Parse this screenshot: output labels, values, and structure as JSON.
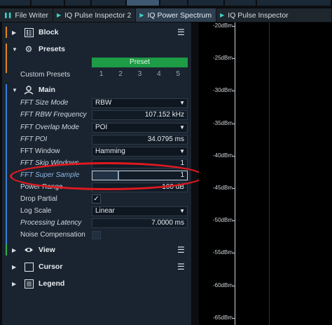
{
  "tabs": [
    {
      "label": "File Writer",
      "icon": "pause-icon",
      "active": false
    },
    {
      "label": "IQ Pulse Inspector 2",
      "icon": "play-icon",
      "active": false
    },
    {
      "label": "IQ Power Spectrum",
      "icon": "play-icon",
      "active": true
    },
    {
      "label": "IQ Pulse Inspector",
      "icon": "play-icon",
      "active": false
    }
  ],
  "sections": {
    "block": {
      "title": "Block",
      "expanded": false
    },
    "presets": {
      "title": "Presets",
      "expanded": true,
      "preset_button": "Preset",
      "custom_presets_label": "Custom Presets",
      "numbers": [
        "1",
        "2",
        "3",
        "4",
        "5"
      ]
    },
    "main": {
      "title": "Main",
      "expanded": true
    },
    "view": {
      "title": "View",
      "expanded": false
    },
    "cursor": {
      "title": "Cursor",
      "expanded": false
    },
    "legend": {
      "title": "Legend",
      "expanded": false
    }
  },
  "properties": {
    "fft_size_mode": {
      "label": "FFT Size Mode",
      "value": "RBW"
    },
    "fft_rbw_frequency": {
      "label": "FFT RBW Frequency",
      "value": "107.152 kHz"
    },
    "fft_overlap_mode": {
      "label": "FFT Overlap Mode",
      "value": "POI"
    },
    "fft_poi": {
      "label": "FFT POI",
      "value": "34.0795 ms"
    },
    "fft_window": {
      "label": "FFT Window",
      "value": "Hamming"
    },
    "fft_skip_windows": {
      "label": "FFT Skip Windows",
      "value": "1"
    },
    "fft_super_sample": {
      "label": "FFT Super Sample",
      "value": "1",
      "level": 0.27
    },
    "power_range": {
      "label": "Power Range",
      "value": "100 dB"
    },
    "drop_partial": {
      "label": "Drop Partial",
      "checked": true,
      "check_glyph": "✓"
    },
    "log_scale": {
      "label": "Log Scale",
      "value": "Linear"
    },
    "processing_latency": {
      "label": "Processing Latency",
      "value": "7.0000 ms"
    },
    "noise_compensation": {
      "label": "Noise Compensation"
    }
  },
  "spectrum": {
    "ticks": [
      "-20dBm",
      "-25dBm",
      "-30dBm",
      "-35dBm",
      "-40dBm",
      "-45dBm",
      "-50dBm",
      "-55dBm",
      "-60dBm",
      "-65dBm"
    ]
  },
  "colors": {
    "panel_bg": "#1a2430",
    "preset_green": "#1d9b45",
    "accent_teal": "#3bd1c6",
    "highlight_red": "#e0191f",
    "bar_orange": "#e0861c",
    "bar_blue": "#3b7dd8",
    "bar_green": "#2fb04a"
  },
  "icons": {
    "section_arrow_down": "▼",
    "section_arrow_right": "▶",
    "dropdown": "▼",
    "menu": "☰"
  }
}
